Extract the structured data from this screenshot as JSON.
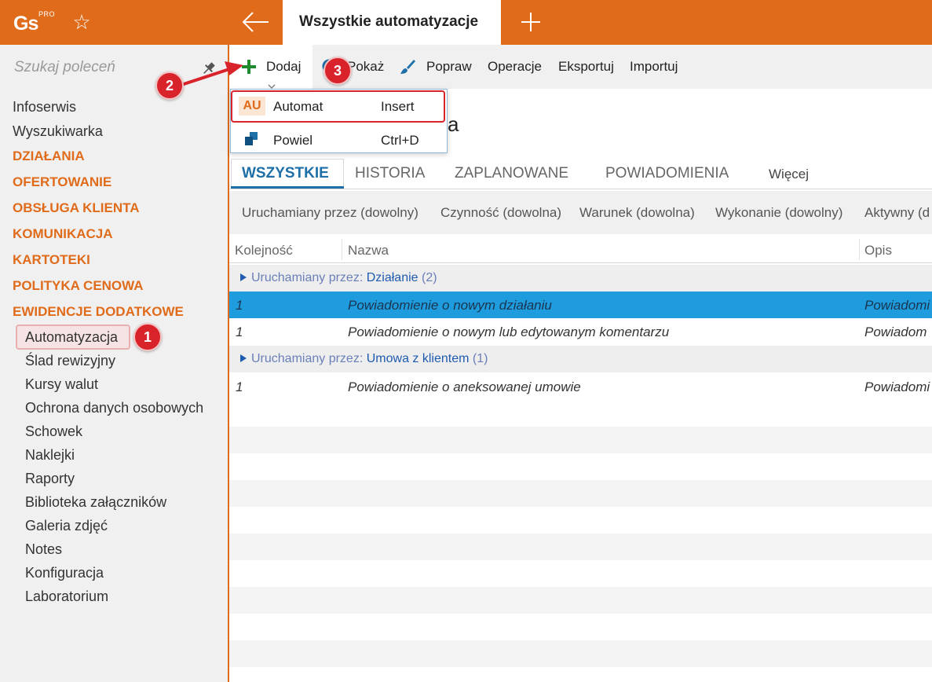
{
  "topbar": {
    "logo_text": "Gs",
    "logo_sup": "PRO",
    "active_tab": "Wszystkie automatyzacje",
    "accent": "#e06b1a"
  },
  "sidebar": {
    "search_placeholder": "Szukaj poleceń",
    "top_items": [
      "Infoserwis",
      "Wyszukiwarka"
    ],
    "categories": [
      "DZIAŁANIA",
      "OFERTOWANIE",
      "OBSŁUGA KLIENTA",
      "KOMUNIKACJA",
      "KARTOTEKI",
      "POLITYKA CENOWA",
      "EWIDENCJE DODATKOWE"
    ],
    "sub_items": [
      "Automatyzacja",
      "Ślad rewizyjny",
      "Kursy walut",
      "Ochrona danych osobowych",
      "Schowek",
      "Naklejki",
      "Raporty",
      "Biblioteka załączników",
      "Galeria zdjęć",
      "Notes",
      "Konfiguracja",
      "Laboratorium"
    ]
  },
  "toolbar": {
    "dodaj": "Dodaj",
    "pokaz": "Pokaż",
    "popraw": "Popraw",
    "operacje": "Operacje",
    "eksportuj": "Eksportuj",
    "importuj": "Importuj"
  },
  "dropdown": {
    "items": [
      {
        "icon": "AU",
        "label": "Automat",
        "shortcut": "Insert"
      },
      {
        "label": "Powiel",
        "shortcut": "Ctrl+D"
      }
    ]
  },
  "heading_fragment": "a",
  "tabs": [
    "WSZYSTKIE",
    "HISTORIA",
    "ZAPLANOWANE",
    "POWIADOMIENIA",
    "Więcej"
  ],
  "filters": [
    "Uruchamiany przez (dowolny)",
    "Czynność (dowolna)",
    "Warunek (dowolna)",
    "Wykonanie (dowolny)",
    "Aktywny (d"
  ],
  "table": {
    "columns": [
      "Kolejność",
      "Nazwa",
      "Opis"
    ],
    "groups": [
      {
        "prefix": "Uruchamiany przez:",
        "value": "Działanie",
        "count": "(2)",
        "rows": [
          {
            "order": "1",
            "name": "Powiadomienie o nowym działaniu",
            "desc": "Powiadomi"
          },
          {
            "order": "1",
            "name": "Powiadomienie o nowym lub edytowanym komentarzu",
            "desc": "Powiadom"
          }
        ]
      },
      {
        "prefix": "Uruchamiany przez:",
        "value": "Umowa z klientem",
        "count": "(1)",
        "rows": [
          {
            "order": "1",
            "name": "Powiadomienie o aneksowanej umowie",
            "desc": "Powiadomi"
          }
        ]
      }
    ]
  },
  "callouts": [
    "1",
    "2",
    "3"
  ]
}
